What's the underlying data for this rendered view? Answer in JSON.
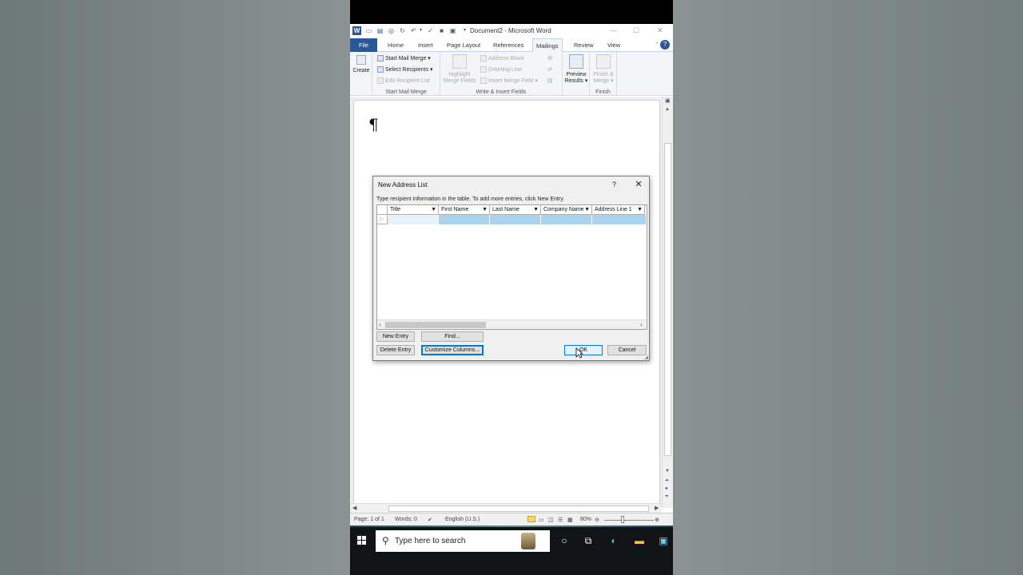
{
  "window": {
    "title": "Document2 - Microsoft Word",
    "logo": "W",
    "qat_icons": [
      "open-icon",
      "print-icon",
      "preview-icon",
      "refresh-icon",
      "undo-icon",
      "spelling-icon",
      "save-icon",
      "quickprint-icon",
      "customize-icon"
    ]
  },
  "tabs": [
    {
      "label": "File"
    },
    {
      "label": "Home"
    },
    {
      "label": "Insert"
    },
    {
      "label": "Page Layout"
    },
    {
      "label": "References"
    },
    {
      "label": "Mailings"
    },
    {
      "label": "Review"
    },
    {
      "label": "View"
    }
  ],
  "ribbon": {
    "create": {
      "label": "Create",
      "group": ""
    },
    "start": {
      "start_mail_merge": "Start Mail Merge",
      "select_recipients": "Select Recipients",
      "edit_recipient_list": "Edit Recipient List",
      "group": "Start Mail Merge"
    },
    "write": {
      "highlight_line1": "Highlight",
      "highlight_line2": "Merge Fields",
      "address_block": "Address Block",
      "greeting_line": "Greeting Line",
      "insert_merge_field": "Insert Merge Field",
      "group": "Write & Insert Fields"
    },
    "preview": {
      "line1": "Preview",
      "line2": "Results"
    },
    "finish": {
      "line1": "Finish &",
      "line2": "Merge",
      "group": "Finish"
    }
  },
  "document": {
    "pilcrow": "¶"
  },
  "status": {
    "page": "Page: 1 of 1",
    "words": "Words: 0",
    "language": "English (U.S.)",
    "zoom": "80%"
  },
  "taskbar": {
    "search_placeholder": "Type here to search"
  },
  "dialog": {
    "title": "New Address List",
    "help": "?",
    "close": "✕",
    "instructions": "Type recipient information in the table.  To add more entries, click New Entry.",
    "columns": [
      "Title",
      "First Name",
      "Last Name",
      "Company Name",
      "Address Line 1"
    ],
    "buttons": {
      "new_entry": "New Entry",
      "find": "Find...",
      "delete_entry": "Delete Entry",
      "customize_columns": "Customize Columns...",
      "ok": "OK",
      "cancel": "Cancel"
    }
  },
  "colors": {
    "accent": "#2b579a",
    "selection": "#a8d2f0",
    "focus": "#0078d7"
  }
}
